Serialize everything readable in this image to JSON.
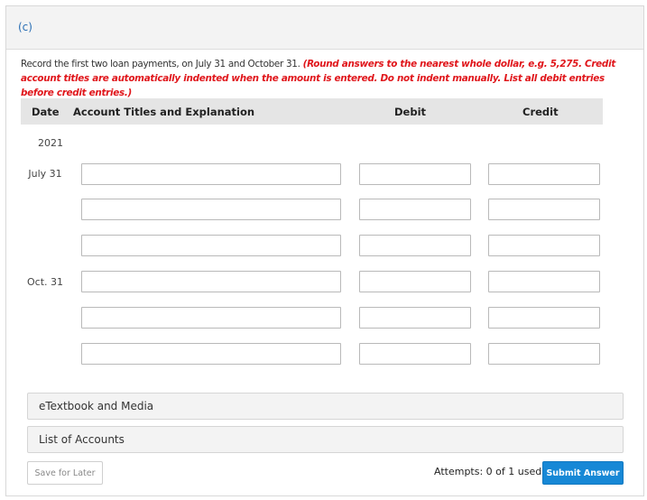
{
  "part": {
    "label": "(c)"
  },
  "instructions": {
    "text": "Record the first two loan payments, on July 31 and October 31.",
    "note": "(Round answers to the nearest whole dollar, e.g. 5,275. Credit account titles are automatically indented when the amount is entered. Do not indent manually. List all debit entries before credit entries.)"
  },
  "table": {
    "headers": {
      "date": "Date",
      "account": "Account Titles and Explanation",
      "debit": "Debit",
      "credit": "Credit"
    },
    "year": "2021",
    "entries": [
      {
        "date": "July 31"
      },
      {
        "date": "Oct. 31"
      }
    ]
  },
  "accordions": [
    {
      "label": "eTextbook and Media"
    },
    {
      "label": "List of Accounts"
    }
  ],
  "footer": {
    "save_label": "Save for Later",
    "attempts": "Attempts: 0 of 1 used",
    "submit_label": "Submit Answer"
  },
  "colors": {
    "accent": "#1788d6",
    "note": "#e0161b",
    "part_label": "#2a6fb5"
  }
}
